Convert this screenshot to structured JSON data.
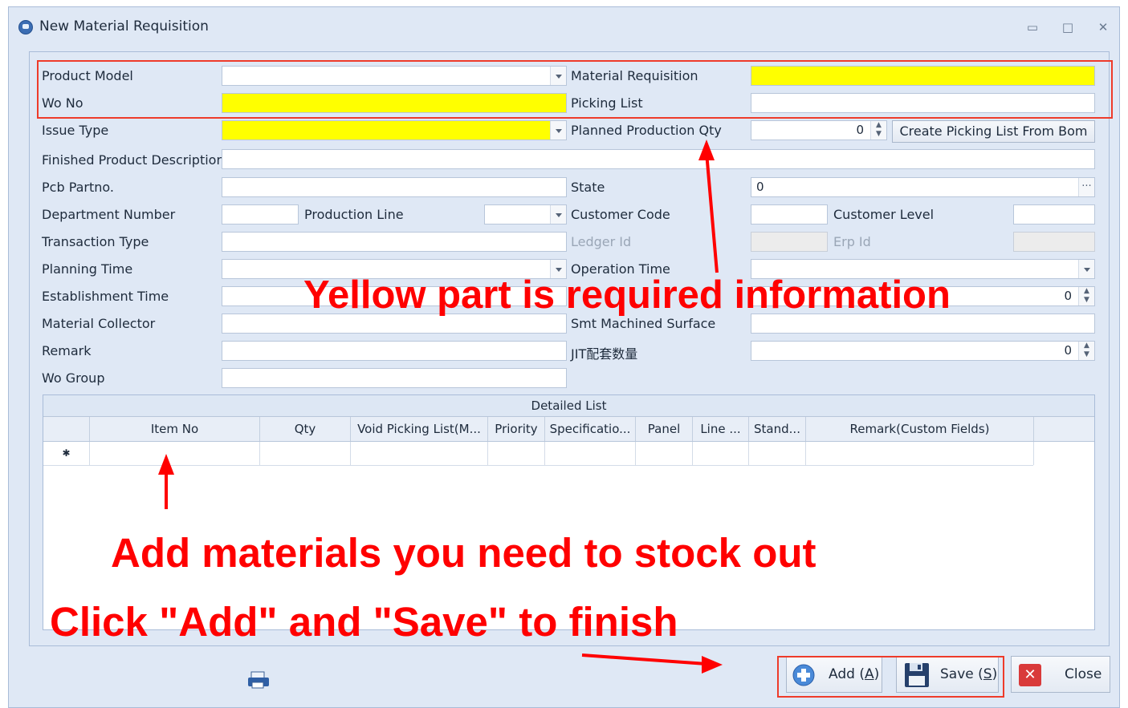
{
  "window": {
    "title": "New Material Requisition"
  },
  "form": {
    "product_model": "Product Model",
    "wo_no": "Wo No",
    "issue_type": "Issue Type",
    "finished_desc": "Finished Product Description",
    "pcb_partno": "Pcb Partno.",
    "dept_number": "Department Number",
    "production_line": "Production Line",
    "transaction_type": "Transaction Type",
    "planning_time": "Planning Time",
    "establishment_time": "Establishment Time",
    "material_collector": "Material Collector",
    "remark": "Remark",
    "wo_group": "Wo Group",
    "material_requisition": "Material Requisition",
    "picking_list": "Picking List",
    "planned_qty": "Planned Production Qty",
    "planned_qty_value": "0",
    "state": "State",
    "state_value": "0",
    "customer_code": "Customer Code",
    "customer_level": "Customer Level",
    "ledger_id": "Ledger Id",
    "erp_id": "Erp Id",
    "operation_time": "Operation Time",
    "station_value": "0",
    "smt_surface": "Smt Machined Surface",
    "jit_qty": "JIT配套数量",
    "jit_qty_value": "0",
    "create_picking_btn": "Create Picking List From Bom"
  },
  "grid": {
    "caption": "Detailed List",
    "columns": [
      "Item No",
      "Qty",
      "Void Picking List(M...",
      "Priority",
      "Specificatio...",
      "Panel",
      "Line ...",
      "Stand...",
      "Remark(Custom Fields)"
    ],
    "new_row_marker": "✱"
  },
  "footer": {
    "add_label": "Add (",
    "add_key": "A",
    "save_label": "Save (",
    "save_key": "S",
    "close_label": "Close"
  },
  "annotations": {
    "yellow_note": "Yellow part is required information",
    "add_note": "Add materials you need to stock out",
    "finish_note": "Click \"Add\" and \"Save\" to finish"
  },
  "colors": {
    "required": "#ffff00",
    "annotation": "#ff0000"
  }
}
